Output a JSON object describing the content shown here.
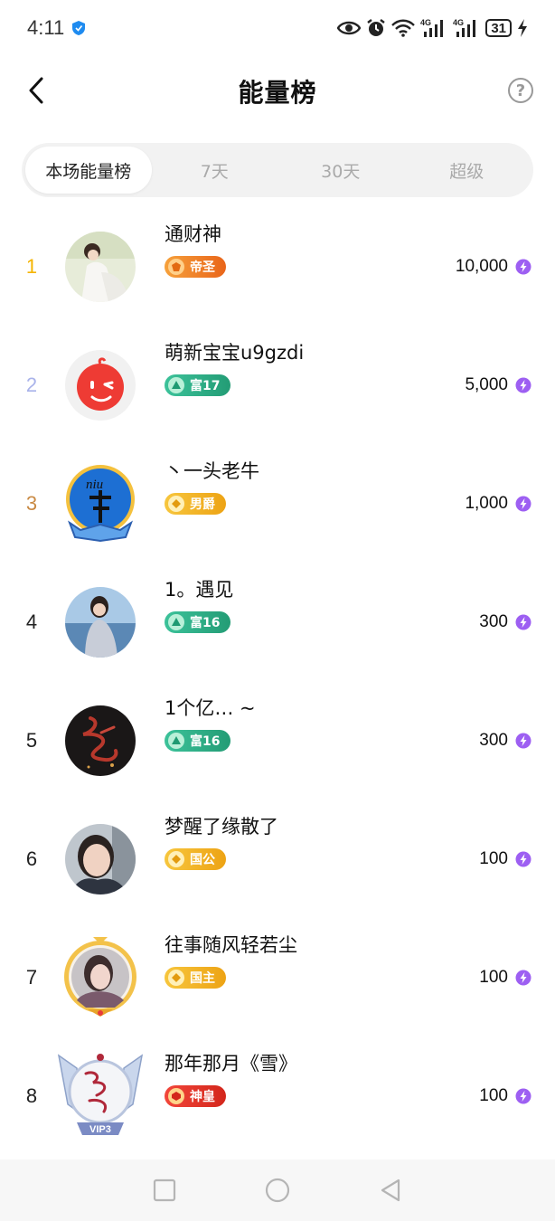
{
  "status_bar": {
    "time": "4:11",
    "battery": "31",
    "icons": [
      "shield-icon",
      "eye-icon",
      "alarm-icon",
      "wifi-icon",
      "signal-4g-icon",
      "signal-4g-icon",
      "battery-icon",
      "charging-icon"
    ]
  },
  "header": {
    "title": "能量榜",
    "back_icon": "chevron-left-icon",
    "help_icon": "question-circle-icon"
  },
  "tabs": [
    {
      "label": "本场能量榜",
      "active": true
    },
    {
      "label": "7天",
      "active": false
    },
    {
      "label": "30天",
      "active": false
    },
    {
      "label": "超级",
      "active": false
    }
  ],
  "rank_colors": {
    "1": "#f5b400",
    "2": "#a9b3ea",
    "3": "#c98a44",
    "default": "#222222"
  },
  "entries": [
    {
      "rank": "1",
      "name": "通财神",
      "badge": "帝圣",
      "badge_color": "#f07a22",
      "score": "10,000",
      "avatar": "portrait-woman-white-dress"
    },
    {
      "rank": "2",
      "name": "萌新宝宝u9gzdi",
      "badge": "富17",
      "badge_color": "#2fb38a",
      "score": "5,000",
      "avatar": "red-wink-face"
    },
    {
      "rank": "3",
      "name": "丶一头老牛",
      "badge": "男爵",
      "badge_color": "#f1b21f",
      "score": "1,000",
      "avatar": "niu-character-frame"
    },
    {
      "rank": "4",
      "name": "1。遇见",
      "badge": "富16",
      "badge_color": "#2fb38a",
      "score": "300",
      "avatar": "portrait-woman-seaside"
    },
    {
      "rank": "5",
      "name": "1个亿…  ~",
      "badge": "富16",
      "badge_color": "#2fb38a",
      "score": "300",
      "avatar": "dark-red-calligraphy"
    },
    {
      "rank": "6",
      "name": "梦醒了缘散了",
      "badge": "国公",
      "badge_color": "#f1b21f",
      "score": "100",
      "avatar": "portrait-woman-selfie"
    },
    {
      "rank": "7",
      "name": "往事随风轻若尘",
      "badge": "国主",
      "badge_color": "#f1b21f",
      "score": "100",
      "avatar": "portrait-woman-gold-frame"
    },
    {
      "rank": "8",
      "name": "那年那月《雪》",
      "badge": "神皇",
      "badge_color": "#e8382a",
      "score": "100",
      "avatar": "vip3-emblem"
    }
  ],
  "score_icon": "lightning-bolt-icon",
  "nav": [
    "recent-apps-icon",
    "home-icon",
    "back-triangle-icon"
  ]
}
